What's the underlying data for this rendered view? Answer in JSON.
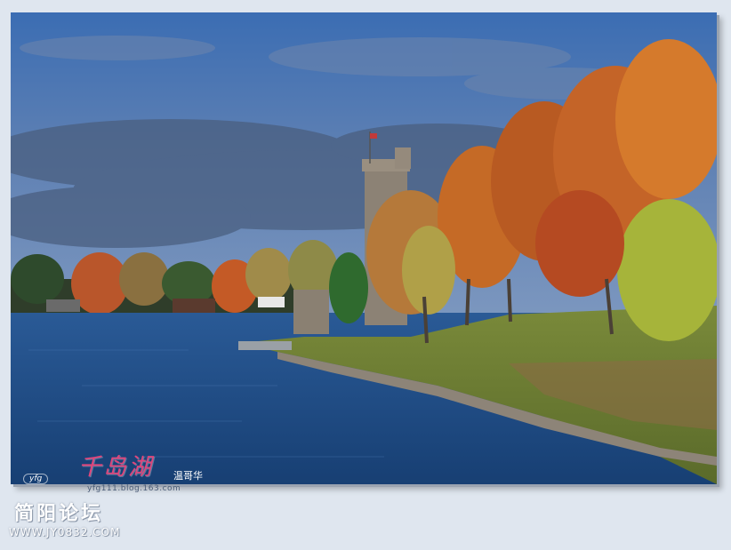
{
  "watermark": {
    "title": "千岛湖",
    "author": "温哥华",
    "blog": "yfg111.blog.163.com",
    "mark": "yfg"
  },
  "forum": {
    "name": "简阳论坛",
    "url": "WWW.JY0832.COM"
  },
  "colors": {
    "sky": "#3f6fb2",
    "water": "#1e4f8c",
    "background": "#dfe6ef"
  }
}
